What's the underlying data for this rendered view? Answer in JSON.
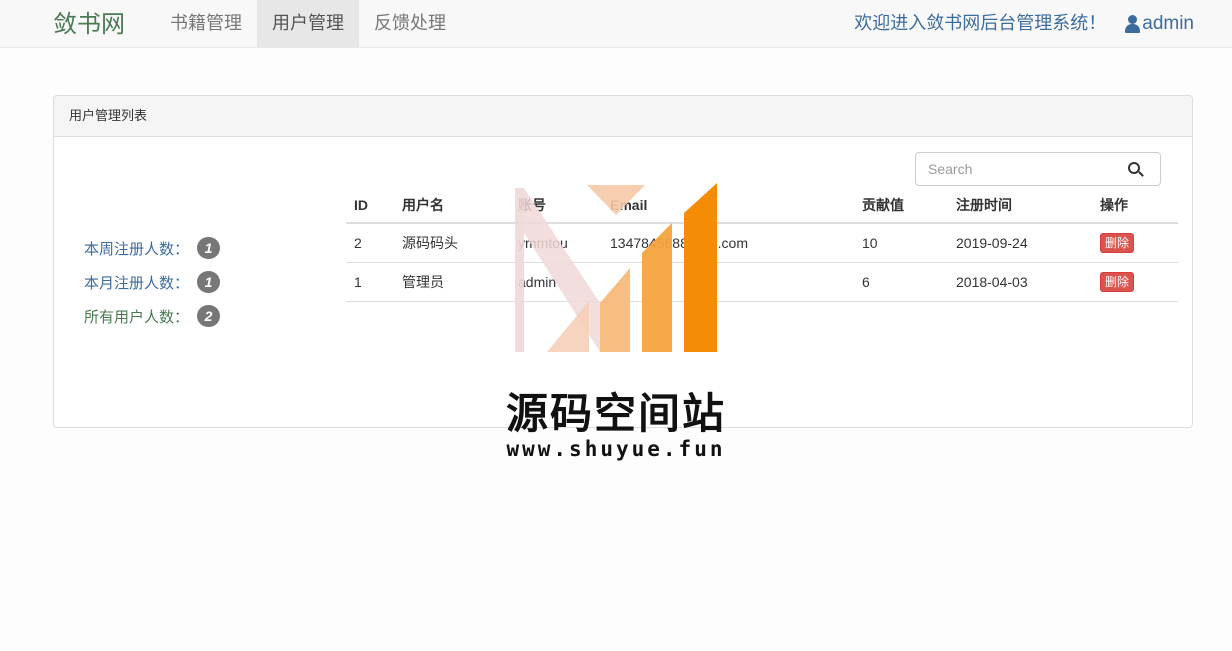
{
  "navbar": {
    "brand": "敛书网",
    "items": [
      {
        "label": "书籍管理",
        "active": false
      },
      {
        "label": "用户管理",
        "active": true
      },
      {
        "label": "反馈处理",
        "active": false
      }
    ],
    "welcome": "欢迎进入敛书网后台管理系统！",
    "user": "admin"
  },
  "panel": {
    "title": "用户管理列表"
  },
  "stats": [
    {
      "label": "本周注册人数：",
      "count": "1"
    },
    {
      "label": "本月注册人数：",
      "count": "1"
    },
    {
      "label": "所有用户人数：",
      "count": "2"
    }
  ],
  "search": {
    "placeholder": "Search"
  },
  "table": {
    "columns": [
      "ID",
      "用户名",
      "账号",
      "Email",
      "贡献值",
      "注册时间",
      "操作"
    ],
    "rows": [
      {
        "id": "2",
        "username": "源码码头",
        "account": "ymmtou",
        "email": "1347845688@qq.com",
        "contribution": "10",
        "registered": "2019-09-24",
        "action": "删除"
      },
      {
        "id": "1",
        "username": "管理员",
        "account": "admin",
        "email": "",
        "contribution": "6",
        "registered": "2018-04-03",
        "action": "删除"
      }
    ]
  },
  "watermark": {
    "title": "源码空间站",
    "url": "www.shuyue.fun"
  },
  "colors": {
    "brand": "#4a7a52",
    "link": "#3c6c9c",
    "danger": "#d9534f",
    "badge": "#777777"
  }
}
